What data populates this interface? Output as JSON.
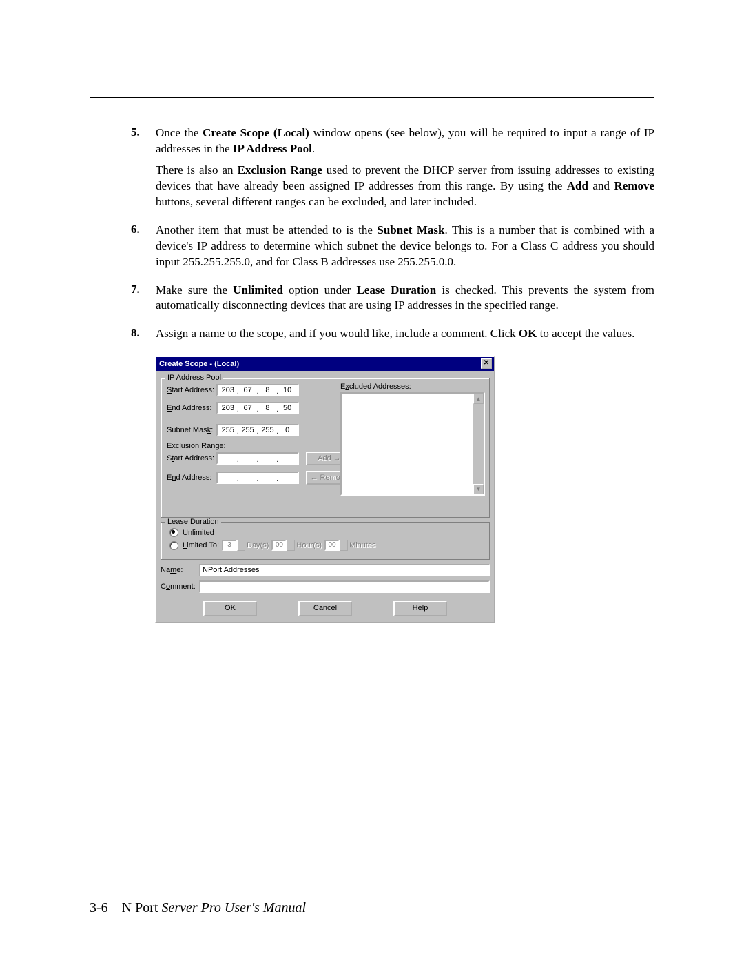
{
  "steps": [
    {
      "num": "5.",
      "paras": [
        {
          "runs": [
            {
              "t": "Once the "
            },
            {
              "t": "Create Scope (Local)",
              "b": true
            },
            {
              "t": " window opens (see below), you will be required to input a range of IP addresses in the "
            },
            {
              "t": "IP Address Pool",
              "b": true
            },
            {
              "t": "."
            }
          ]
        },
        {
          "runs": [
            {
              "t": "There is also an "
            },
            {
              "t": "Exclusion Range",
              "b": true
            },
            {
              "t": " used to prevent the DHCP server from issuing addresses to existing devices that have already been assigned IP addresses from this range. By using the "
            },
            {
              "t": "Add",
              "b": true
            },
            {
              "t": " and "
            },
            {
              "t": "Remove",
              "b": true
            },
            {
              "t": " buttons, several different ranges can be excluded, and later included."
            }
          ]
        }
      ]
    },
    {
      "num": "6.",
      "paras": [
        {
          "runs": [
            {
              "t": "Another item that must be attended to is the "
            },
            {
              "t": "Subnet Mask",
              "b": true
            },
            {
              "t": ". This is a number that is combined with a device's IP address to determine which subnet the device belongs to. For a Class C address you should input 255.255.255.0, and for Class B addresses use 255.255.0.0."
            }
          ]
        }
      ]
    },
    {
      "num": "7.",
      "paras": [
        {
          "runs": [
            {
              "t": "Make sure the "
            },
            {
              "t": "Unlimited",
              "b": true
            },
            {
              "t": " option under "
            },
            {
              "t": "Lease Duration",
              "b": true
            },
            {
              "t": " is checked. This prevents the system from automatically disconnecting devices that are using IP addresses in the specified range."
            }
          ]
        }
      ]
    },
    {
      "num": "8.",
      "paras": [
        {
          "runs": [
            {
              "t": "Assign a name to the scope, and if you would like, include a comment. Click "
            },
            {
              "t": "OK",
              "b": true
            },
            {
              "t": " to accept the values."
            }
          ]
        }
      ]
    }
  ],
  "dialog": {
    "title": "Create Scope - (Local)",
    "ip_pool": {
      "legend": "IP Address Pool",
      "start_label": "Start Address:",
      "start_value": [
        "203",
        "67",
        "8",
        "10"
      ],
      "end_label": "End Address:",
      "end_value": [
        "203",
        "67",
        "8",
        "50"
      ],
      "mask_label": "Subnet Mask:",
      "mask_value": [
        "255",
        "255",
        "255",
        "0"
      ],
      "excl_legend": "Exclusion Range:",
      "ex_start_label": "Start Address:",
      "ex_start_value": [
        "",
        "",
        "",
        ""
      ],
      "ex_end_label": "End Address:",
      "ex_end_value": [
        "",
        "",
        "",
        ""
      ],
      "add_btn": "Add →",
      "remove_btn": "← Remove",
      "excluded_label": "Excluded Addresses:"
    },
    "lease": {
      "legend": "Lease Duration",
      "unlimited": "Unlimited",
      "limited": "Limited To:",
      "days_val": "3",
      "days_lbl": "Day(s)",
      "hours_val": "00",
      "hours_lbl": "Hour(s)",
      "mins_val": "00",
      "mins_lbl": "Minutes"
    },
    "name_label": "Name:",
    "name_value": "NPort Addresses",
    "comment_label": "Comment:",
    "comment_value": "",
    "ok": "OK",
    "cancel": "Cancel",
    "help_pre": "H",
    "help_u": "e",
    "help_post": "lp"
  },
  "footer": {
    "page": "3-6",
    "prefix": "N Port ",
    "italic": "Server Pro User's Manual"
  }
}
